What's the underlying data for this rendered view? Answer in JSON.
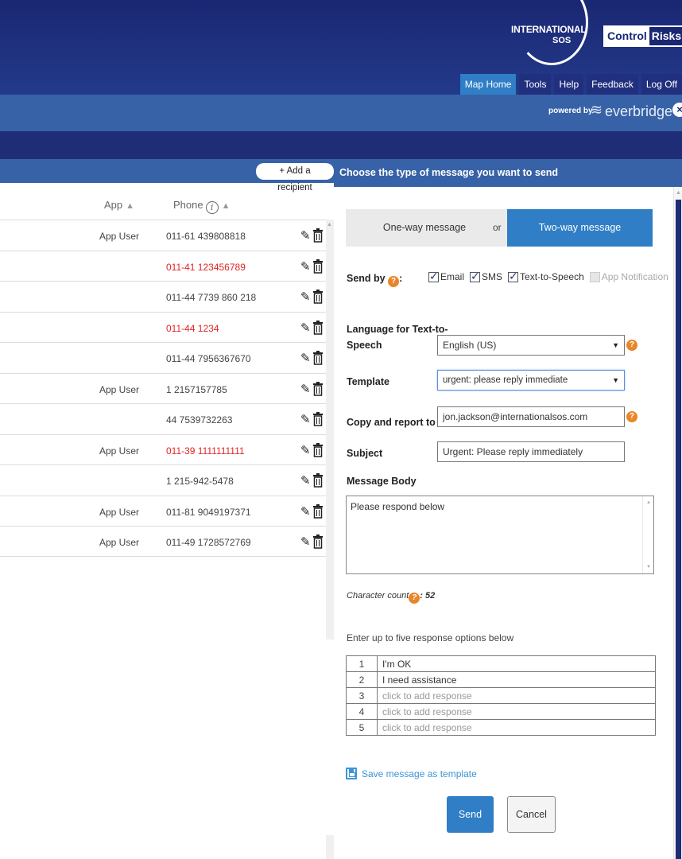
{
  "header": {
    "logo_isos_line1": "INTERNATIONAL",
    "logo_isos_line2": "SOS",
    "logo_cr_part1": "Control",
    "logo_cr_part2": "Risks",
    "nav": [
      {
        "label": "Map Home",
        "active": true
      },
      {
        "label": "Tools"
      },
      {
        "label": "Help"
      },
      {
        "label": "Feedback"
      },
      {
        "label": "Log Off"
      }
    ],
    "powered_by": "powered by",
    "everbridge": "everbridge",
    "accent_color": "#2f7ec6",
    "navy_color": "#1f2c76"
  },
  "recipients": {
    "add_button": "+ Add a recipient",
    "columns": {
      "app": "App",
      "phone": "Phone"
    },
    "rows": [
      {
        "app": "App User",
        "phone": "011-61 439808818",
        "invalid": false
      },
      {
        "app": "",
        "phone": "011-41 123456789",
        "invalid": true
      },
      {
        "app": "",
        "phone": "011-44 7739 860 218",
        "invalid": false
      },
      {
        "app": "",
        "phone": "011-44 1234",
        "invalid": true
      },
      {
        "app": "",
        "phone": "011-44 7956367670",
        "invalid": false
      },
      {
        "app": "App User",
        "phone": "1 2157157785",
        "invalid": false
      },
      {
        "app": "",
        "phone": "44 7539732263",
        "invalid": false
      },
      {
        "app": "App User",
        "phone": "011-39 1111111111",
        "invalid": true
      },
      {
        "app": "",
        "phone": "1 215-942-5478",
        "invalid": false
      },
      {
        "app": "App User",
        "phone": "011-81 9049197371",
        "invalid": false
      },
      {
        "app": "App User",
        "phone": "011-49 1728572769",
        "invalid": false
      }
    ]
  },
  "compose": {
    "title": "Choose the type of message you want to send",
    "one_way": "One-way message",
    "or": "or",
    "two_way": "Two-way message",
    "send_by_label": "Send by",
    "send_by": [
      {
        "label": "Email",
        "checked": true,
        "disabled": false
      },
      {
        "label": "SMS",
        "checked": true,
        "disabled": false
      },
      {
        "label": "Text-to-Speech",
        "checked": true,
        "disabled": false
      },
      {
        "label": "App Notification",
        "checked": false,
        "disabled": true
      }
    ],
    "language_label_1": "Language for Text-to-",
    "language_label_2": "Speech",
    "language_value": "English (US)",
    "template_label": "Template",
    "template_value": "urgent: please reply immediate",
    "copy_label": "Copy and report to",
    "copy_value": "jon.jackson@internationalsos.com",
    "subject_label": "Subject",
    "subject_value": "Urgent: Please reply immediately",
    "message_body_label": "Message Body",
    "message_body": "Please respond below",
    "char_count_label": "Character count",
    "char_count_value": ": 52",
    "response_intro": "Enter up to five response options below",
    "responses": [
      {
        "num": "1",
        "text": "I'm OK",
        "placeholder": false
      },
      {
        "num": "2",
        "text": "I need assistance",
        "placeholder": false
      },
      {
        "num": "3",
        "text": "click to add response",
        "placeholder": true
      },
      {
        "num": "4",
        "text": "click to add response",
        "placeholder": true
      },
      {
        "num": "5",
        "text": "click to add response",
        "placeholder": true
      }
    ],
    "save_template": "Save message as template",
    "send": "Send",
    "cancel": "Cancel"
  }
}
